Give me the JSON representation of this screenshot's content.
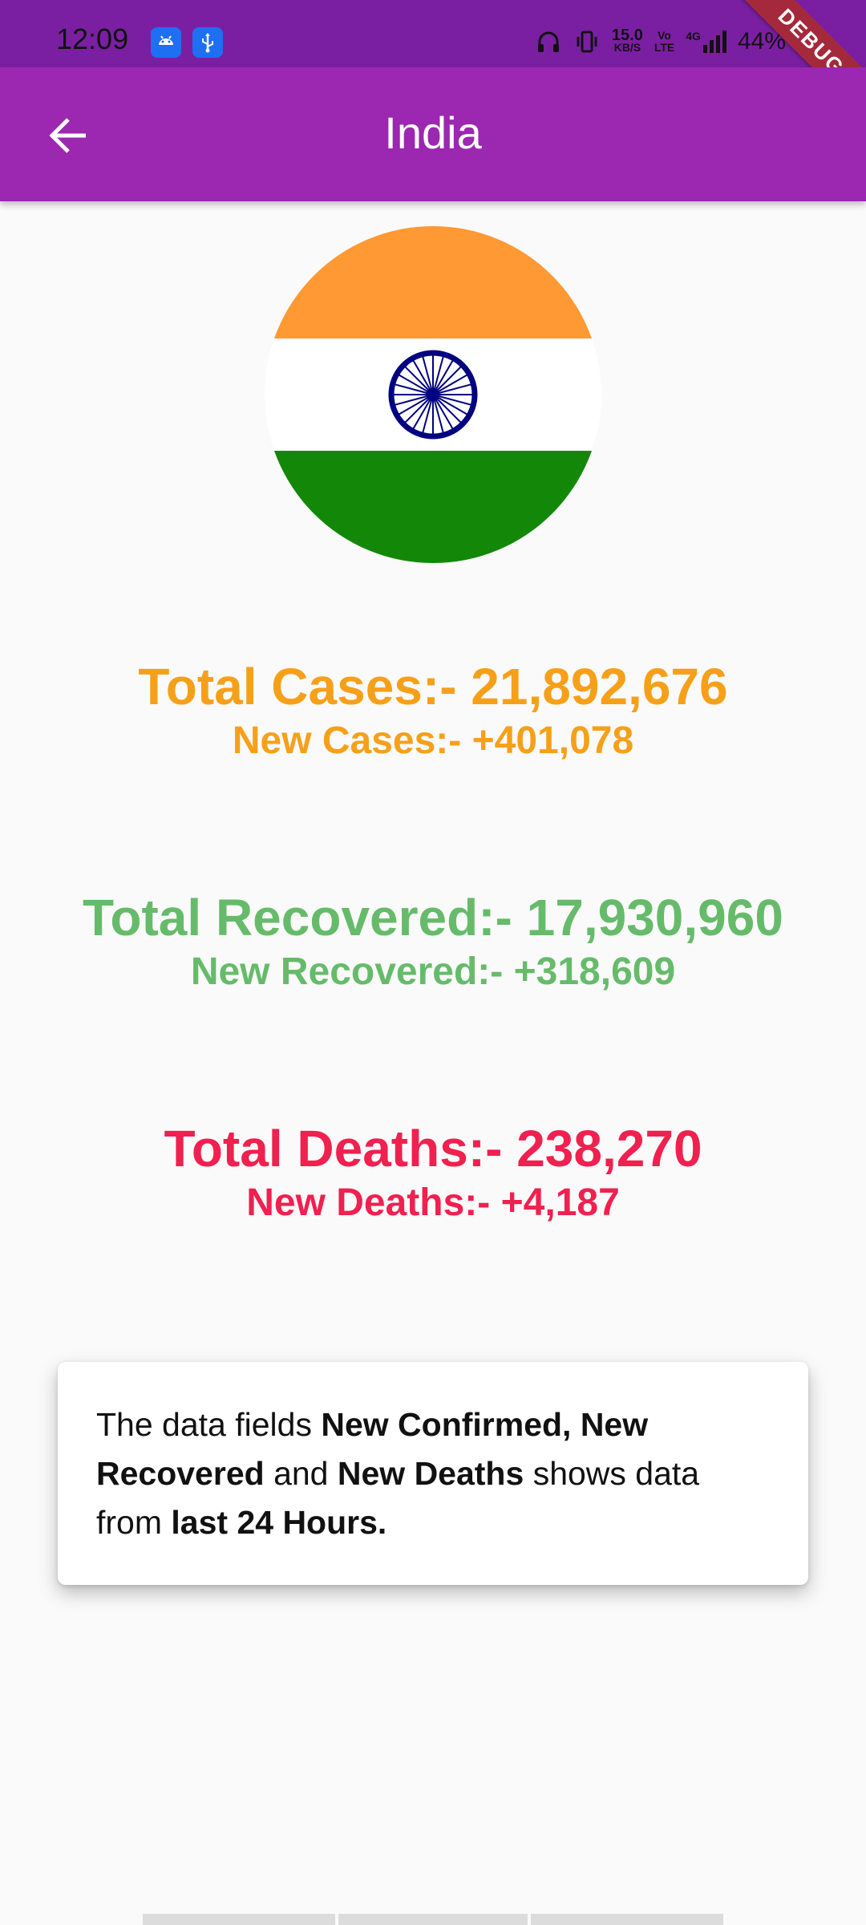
{
  "status_bar": {
    "time": "12:09",
    "net_speed_value": "15.0",
    "net_speed_unit": "KB/S",
    "volte_top": "Vo",
    "volte_bottom": "LTE",
    "network_type": "4G",
    "battery": "44%",
    "icons": [
      "android-icon",
      "usb-icon",
      "headphones-icon",
      "vibrate-icon",
      "signal-icon"
    ]
  },
  "debug_banner": "DEBUG",
  "app_bar": {
    "title": "India",
    "back_icon": "arrow-left-icon",
    "color": "#9c27b0"
  },
  "flag": {
    "country": "India",
    "colors": {
      "saffron": "#ff9933",
      "white": "#ffffff",
      "green": "#138808",
      "chakra": "#000080"
    }
  },
  "stats": {
    "cases": {
      "total_label": "Total Cases:-",
      "total_value": "21,892,676",
      "new_label": "New Cases:-",
      "new_value": "+401,078",
      "color": "#f6a01a"
    },
    "recovered": {
      "total_label": "Total Recovered:-",
      "total_value": "17,930,960",
      "new_label": "New Recovered:-",
      "new_value": "+318,609",
      "color": "#66bb6a"
    },
    "deaths": {
      "total_label": "Total Deaths:-",
      "total_value": "238,270",
      "new_label": "New Deaths:-",
      "new_value": "+4,187",
      "color": "#f0204f"
    }
  },
  "info_card": {
    "part1": "The data fields ",
    "bold1": "New Confirmed, New Recovered",
    "part2": " and ",
    "bold2": "New Deaths",
    "part3": " shows data from ",
    "bold3": "last 24 Hours."
  }
}
